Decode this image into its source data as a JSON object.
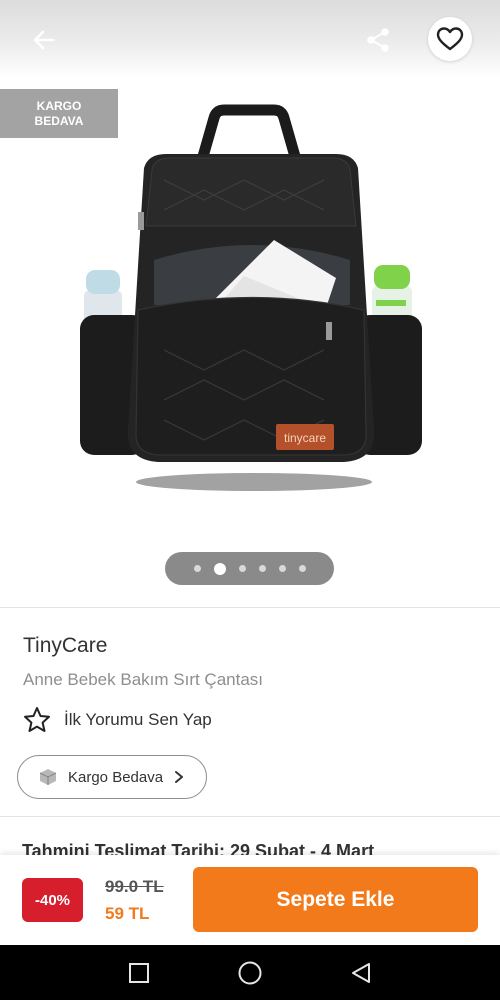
{
  "header": {
    "back_icon": "arrow-left-icon",
    "share_icon": "share-icon",
    "favorite_icon": "heart-icon"
  },
  "image": {
    "ribbon_line1": "KARGO",
    "ribbon_line2": "BEDAVA",
    "bag_logo_text": "tinycare",
    "carousel": {
      "total": 6,
      "active_index": 1
    }
  },
  "product": {
    "brand": "TinyCare",
    "name": "Anne Bebek Bakım Sırt Çantası",
    "review_label": "İlk Yorumu Sen Yap",
    "cargo_label": "Kargo Bedava",
    "delivery_text": "Tahmini Teslimat Tarihi: 29 Şubat - 4 Mart"
  },
  "purchase": {
    "discount_badge": "-40%",
    "old_price": "99.0 TL",
    "new_price": "59 TL",
    "add_to_cart_label": "Sepete Ekle"
  },
  "colors": {
    "accent": "#f27a1a",
    "discount": "#d61e2d",
    "ribbon": "#a3a3a3"
  }
}
